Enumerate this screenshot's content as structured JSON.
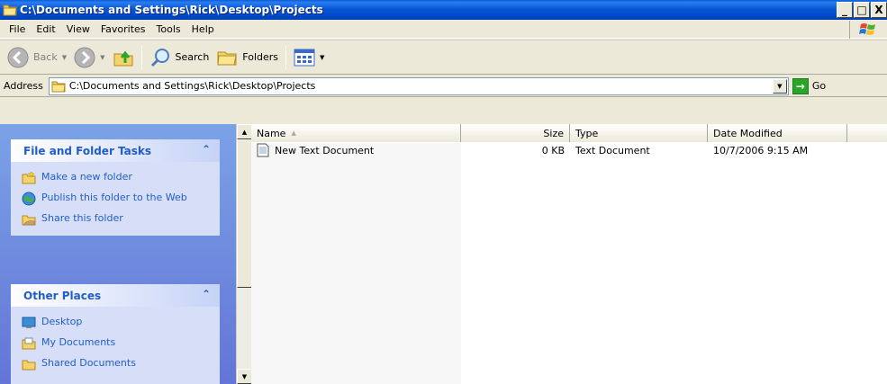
{
  "window": {
    "title": "C:\\Documents and Settings\\Rick\\Desktop\\Projects",
    "buttons": [
      "_",
      "□",
      "X"
    ]
  },
  "menu": {
    "items": [
      {
        "label": "File",
        "accel": "F"
      },
      {
        "label": "Edit",
        "accel": "E"
      },
      {
        "label": "View",
        "accel": "V"
      },
      {
        "label": "Favorites",
        "accel": "a"
      },
      {
        "label": "Tools",
        "accel": "T"
      },
      {
        "label": "Help",
        "accel": "H"
      }
    ]
  },
  "toolbar": {
    "back_label": "Back",
    "search_label": "Search",
    "folders_label": "Folders"
  },
  "address": {
    "label": "Address",
    "value": "C:\\Documents and Settings\\Rick\\Desktop\\Projects",
    "go_label": "Go"
  },
  "tasks": {
    "file_folder": {
      "title": "File and Folder Tasks",
      "items": [
        "Make a new folder",
        "Publish this folder to the Web",
        "Share this folder"
      ]
    },
    "other_places": {
      "title": "Other Places",
      "items": [
        "Desktop",
        "My Documents",
        "Shared Documents"
      ]
    }
  },
  "list": {
    "columns": [
      "Name",
      "Size",
      "Type",
      "Date Modified"
    ],
    "rows": [
      {
        "name": "New Text Document",
        "size": "0 KB",
        "type": "Text Document",
        "date": "10/7/2006 9:15 AM"
      }
    ]
  },
  "colors": {
    "title_bar": "#0858d6",
    "task_link": "#215dc6",
    "left_pane": "#7ba2e7"
  }
}
